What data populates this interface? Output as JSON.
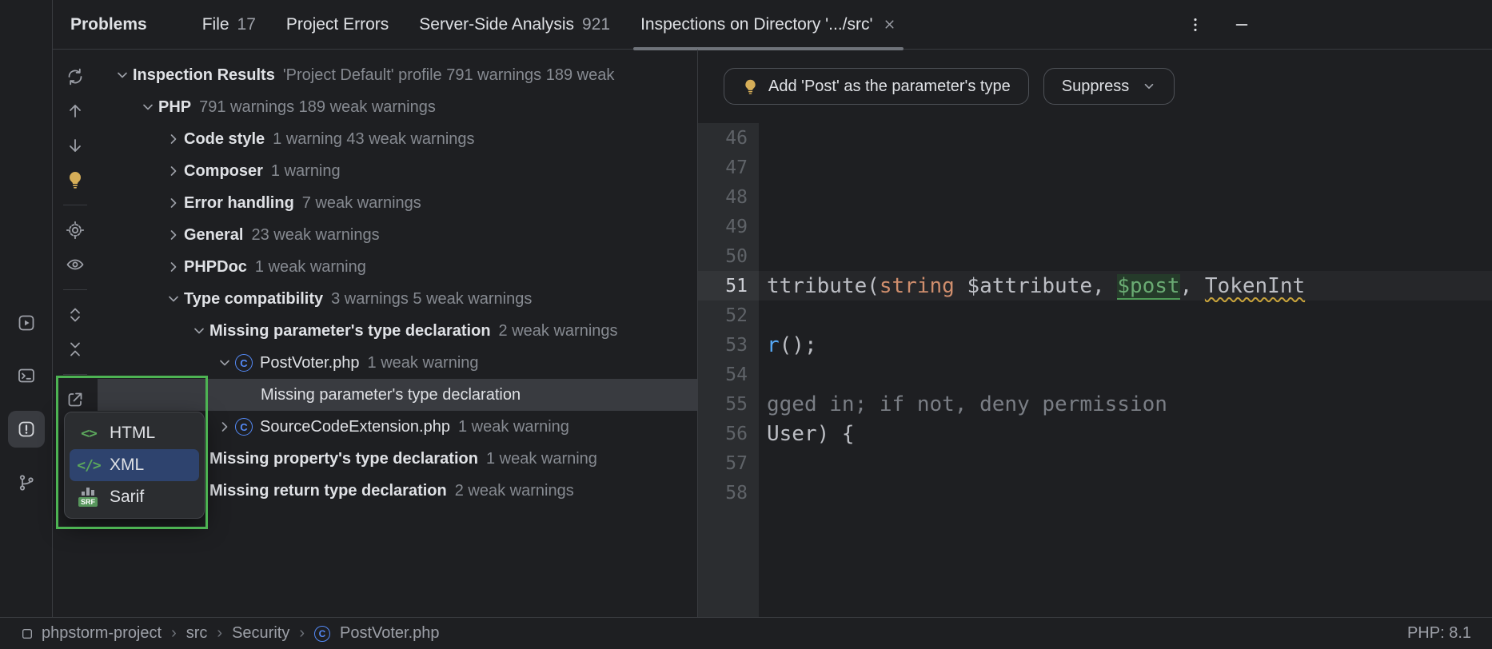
{
  "window_title": "Problems",
  "header": {
    "tabs": [
      {
        "label": "File",
        "count": "17",
        "active": false,
        "closable": false
      },
      {
        "label": "Project Errors",
        "count": "",
        "active": false,
        "closable": false
      },
      {
        "label": "Server-Side Analysis",
        "count": "921",
        "active": false,
        "closable": false
      },
      {
        "label": "Inspections on Directory '.../src'",
        "count": "",
        "active": true,
        "closable": true
      }
    ],
    "actions": [
      {
        "id": "more",
        "icon": "kebab-icon"
      },
      {
        "id": "hide",
        "icon": "minimize-icon"
      }
    ]
  },
  "activity_bar": {
    "items": [
      {
        "id": "services",
        "icon": "services-icon",
        "active": false
      },
      {
        "id": "terminal",
        "icon": "terminal-icon",
        "active": false
      },
      {
        "id": "problems",
        "icon": "problems-icon",
        "active": true
      },
      {
        "id": "version-control",
        "icon": "git-branch-icon",
        "active": false
      }
    ]
  },
  "toolbar": {
    "items": [
      {
        "id": "refresh",
        "icon": "refresh-icon"
      },
      {
        "id": "previous-problem",
        "icon": "arrow-up-icon"
      },
      {
        "id": "next-problem",
        "icon": "arrow-down-icon"
      },
      {
        "id": "quick-fix",
        "icon": "lightbulb-icon"
      },
      {
        "id": "divider"
      },
      {
        "id": "settings",
        "icon": "gear-icon"
      },
      {
        "id": "view-options",
        "icon": "eye-icon"
      },
      {
        "id": "divider"
      },
      {
        "id": "expand-all",
        "icon": "expand-all-icon"
      },
      {
        "id": "collapse-all",
        "icon": "collapse-all-icon"
      },
      {
        "id": "divider"
      },
      {
        "id": "export",
        "icon": "export-icon"
      }
    ]
  },
  "tree": {
    "rows": [
      {
        "level": 0,
        "chevron": "down",
        "icon": null,
        "label": "Inspection Results",
        "bold": true,
        "suffix": "'Project Default' profile 791 warnings 189 weak",
        "selected": false
      },
      {
        "level": 1,
        "chevron": "down",
        "icon": null,
        "label": "PHP",
        "bold": true,
        "suffix": "791 warnings 189 weak warnings",
        "selected": false
      },
      {
        "level": 2,
        "chevron": "right",
        "icon": null,
        "label": "Code style",
        "bold": true,
        "suffix": "1 warning 43 weak warnings",
        "selected": false
      },
      {
        "level": 2,
        "chevron": "right",
        "icon": null,
        "label": "Composer",
        "bold": true,
        "suffix": "1 warning",
        "selected": false
      },
      {
        "level": 2,
        "chevron": "right",
        "icon": null,
        "label": "Error handling",
        "bold": true,
        "suffix": "7 weak warnings",
        "selected": false
      },
      {
        "level": 2,
        "chevron": "right",
        "icon": null,
        "label": "General",
        "bold": true,
        "suffix": "23 weak warnings",
        "selected": false
      },
      {
        "level": 2,
        "chevron": "right",
        "icon": null,
        "label": "PHPDoc",
        "bold": true,
        "suffix": "1 weak warning",
        "selected": false
      },
      {
        "level": 2,
        "chevron": "down",
        "icon": null,
        "label": "Type compatibility",
        "bold": true,
        "suffix": "3 warnings 5 weak warnings",
        "selected": false
      },
      {
        "level": 3,
        "chevron": "down",
        "icon": null,
        "label": "Missing parameter's type declaration",
        "bold": true,
        "suffix": "2 weak warnings",
        "selected": false
      },
      {
        "level": 4,
        "chevron": "down",
        "icon": "class",
        "label": "PostVoter.php",
        "bold": false,
        "suffix": "1 weak warning",
        "selected": false
      },
      {
        "level": 5,
        "chevron": null,
        "icon": null,
        "label": "Missing parameter's type declaration",
        "bold": false,
        "suffix": "",
        "selected": true
      },
      {
        "level": 4,
        "chevron": "right",
        "icon": "class",
        "label": "SourceCodeExtension.php",
        "bold": false,
        "suffix": "1 weak warning",
        "selected": false
      },
      {
        "level": 3,
        "chevron": "right",
        "icon": null,
        "label": "Missing property's type declaration",
        "bold": true,
        "suffix": "1 weak warning",
        "selected": false
      },
      {
        "level": 3,
        "chevron": "right",
        "icon": null,
        "label": "Missing return type declaration",
        "bold": true,
        "suffix": "2 weak warnings",
        "selected": false
      }
    ]
  },
  "export_popup": {
    "items": [
      {
        "icon": "html",
        "label": "HTML",
        "selected": false
      },
      {
        "icon": "xml",
        "label": "XML",
        "selected": true
      },
      {
        "icon": "sarif",
        "label": "Sarif",
        "selected": false
      }
    ],
    "highlight_color": "#4db353"
  },
  "editor": {
    "actions": [
      {
        "id": "quick-fix-add-type",
        "icon": "lightbulb-icon",
        "label": "Add 'Post' as the parameter's type",
        "dropdown": false
      },
      {
        "id": "suppress",
        "icon": null,
        "label": "Suppress",
        "dropdown": true
      }
    ],
    "lines": [
      {
        "num": "46",
        "current": false,
        "segments": []
      },
      {
        "num": "47",
        "current": false,
        "segments": []
      },
      {
        "num": "48",
        "current": false,
        "segments": []
      },
      {
        "num": "49",
        "current": false,
        "segments": []
      },
      {
        "num": "50",
        "current": false,
        "segments": []
      },
      {
        "num": "51",
        "current": true,
        "segments": [
          {
            "t": "ttribute(",
            "c": "plain"
          },
          {
            "t": "string",
            "c": "keyword"
          },
          {
            "t": " $attribute, ",
            "c": "plain"
          },
          {
            "t": "$post",
            "c": "highlight"
          },
          {
            "t": ", ",
            "c": "plain"
          },
          {
            "t": "TokenInt",
            "c": "warn"
          }
        ]
      },
      {
        "num": "52",
        "current": false,
        "segments": []
      },
      {
        "num": "53",
        "current": false,
        "segments": [
          {
            "t": "r",
            "c": "method"
          },
          {
            "t": "();",
            "c": "plain"
          }
        ]
      },
      {
        "num": "54",
        "current": false,
        "segments": []
      },
      {
        "num": "55",
        "current": false,
        "segments": [
          {
            "t": "gged in; if not, deny permission",
            "c": "comment"
          }
        ]
      },
      {
        "num": "56",
        "current": false,
        "segments": [
          {
            "t": "User) {",
            "c": "plain"
          }
        ]
      },
      {
        "num": "57",
        "current": false,
        "segments": []
      },
      {
        "num": "58",
        "current": false,
        "segments": []
      }
    ]
  },
  "status_bar": {
    "breadcrumbs": [
      {
        "icon": "square",
        "label": "phpstorm-project"
      },
      {
        "icon": null,
        "label": "src"
      },
      {
        "icon": null,
        "label": "Security"
      },
      {
        "icon": "class",
        "label": "PostVoter.php"
      }
    ],
    "separator": "›",
    "php_version": "PHP: 8.1"
  }
}
